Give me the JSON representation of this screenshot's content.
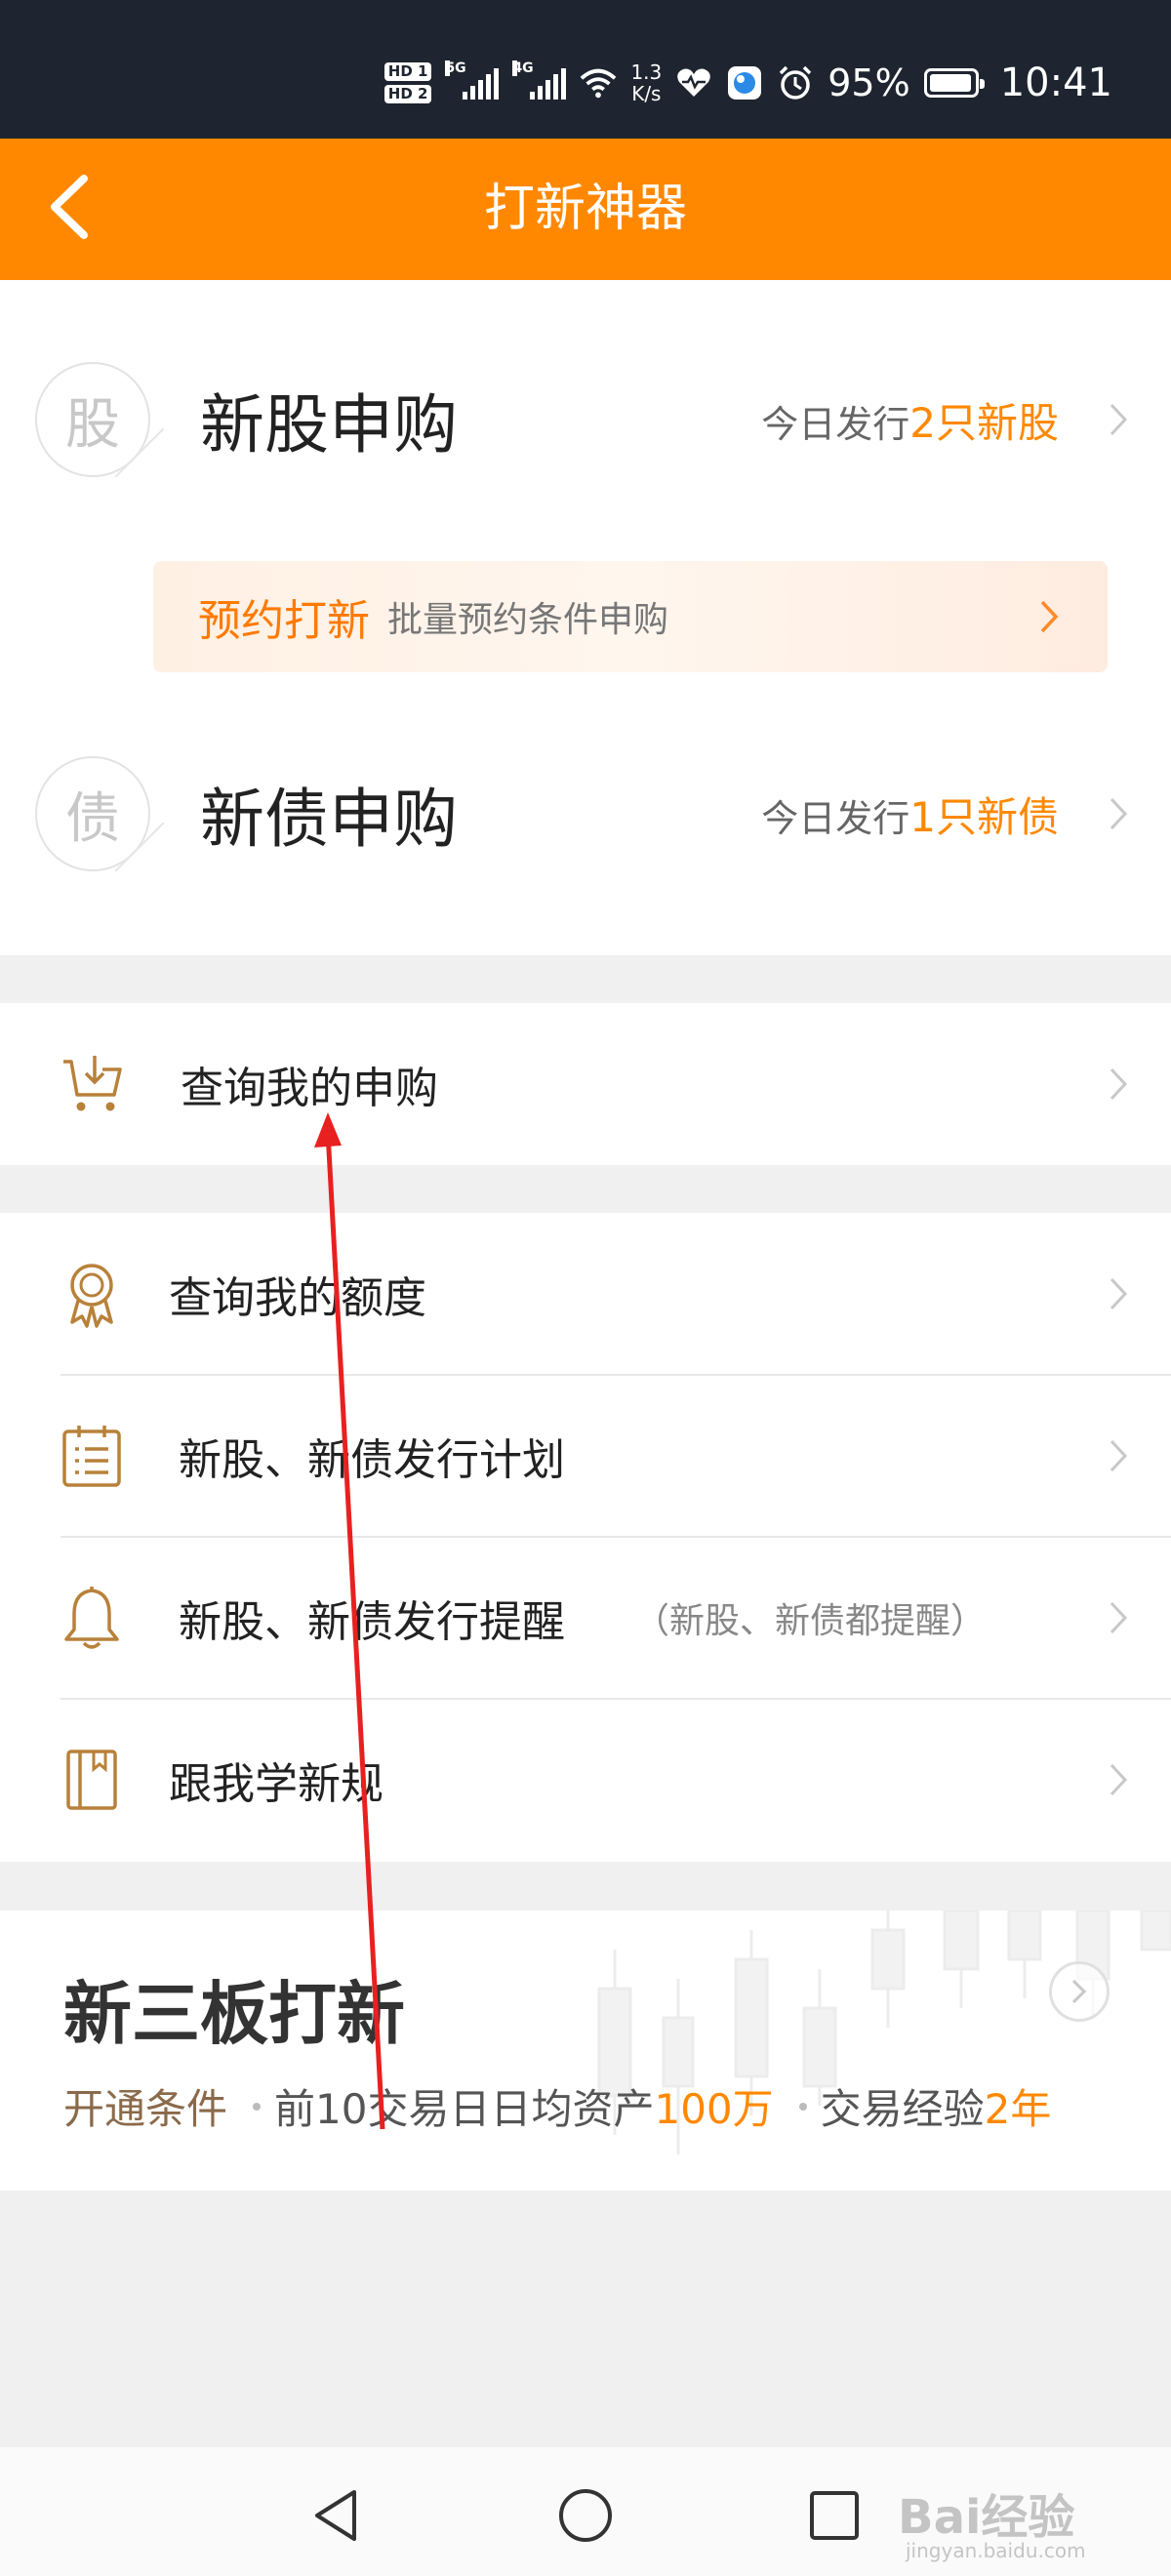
{
  "status_bar": {
    "hd1": "HD 1",
    "hd2": "HD 2",
    "net1": "5G",
    "net2": "4G",
    "speed_value": "1.3",
    "speed_unit": "K/s",
    "battery_percent": "95%",
    "battery_level": 0.95,
    "time": "10:41",
    "icons": [
      "hd-icon",
      "signal-icon",
      "wifi-icon",
      "heart-icon",
      "app-icon",
      "alarm-icon",
      "battery-icon"
    ]
  },
  "header": {
    "title": "打新神器",
    "back_icon": "chevron-left-icon"
  },
  "subscriptions": {
    "stock": {
      "badge": "股",
      "title": "新股申购",
      "info_prefix": "今日发行",
      "info_highlight": "2只新股"
    },
    "reserve": {
      "title": "预约打新",
      "desc": "批量预约条件申购"
    },
    "bond": {
      "badge": "债",
      "title": "新债申购",
      "info_prefix": "今日发行",
      "info_highlight": "1只新债"
    }
  },
  "query_row": {
    "label": "查询我的申购",
    "icon": "cart-download-icon"
  },
  "menu": [
    {
      "label": "查询我的额度",
      "icon": "award-icon",
      "note": ""
    },
    {
      "label": "新股、新债发行计划",
      "icon": "calendar-list-icon",
      "note": ""
    },
    {
      "label": "新股、新债发行提醒",
      "icon": "bell-icon",
      "note": "（新股、新债都提醒）"
    },
    {
      "label": "跟我学新规",
      "icon": "book-icon",
      "note": ""
    }
  ],
  "neeq": {
    "title": "新三板打新",
    "cond_label": "开通条件",
    "cond1_text": "前10交易日日均资产",
    "cond1_value": "100万",
    "cond2_text": "交易经验",
    "cond2_value": "2年"
  },
  "navbar": {
    "back": "nav-back-icon",
    "home": "nav-home-icon",
    "recents": "nav-recents-icon"
  },
  "watermark": {
    "text": "Bai经验",
    "sub": "jingyan.baidu.com"
  },
  "colors": {
    "accent": "#ff8800",
    "status_bar": "#1e2530",
    "annotation": "#e82020"
  }
}
